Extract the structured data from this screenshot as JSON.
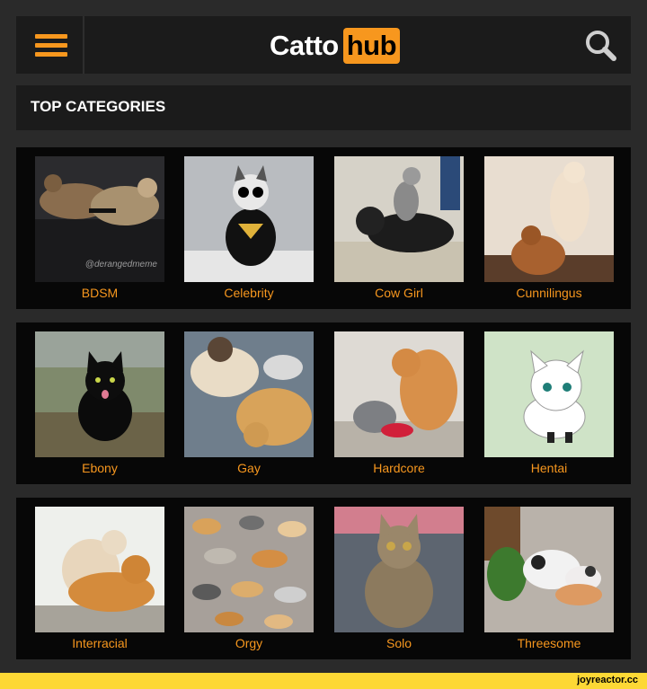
{
  "header": {
    "logo_white": "Catto",
    "logo_orange": "hub"
  },
  "section": {
    "title": "TOP CATEGORIES"
  },
  "categories": [
    {
      "label": "BDSM",
      "watermark": "@derangedmeme"
    },
    {
      "label": "Celebrity"
    },
    {
      "label": "Cow Girl"
    },
    {
      "label": "Cunnilingus"
    },
    {
      "label": "Ebony"
    },
    {
      "label": "Gay"
    },
    {
      "label": "Hardcore"
    },
    {
      "label": "Hentai"
    },
    {
      "label": "Interracial"
    },
    {
      "label": "Orgy"
    },
    {
      "label": "Solo"
    },
    {
      "label": "Threesome"
    }
  ],
  "footer": {
    "source": "joyreactor.cc"
  },
  "colors": {
    "accent": "#f7971e",
    "bar_bg": "#1b1b1b",
    "page_bg": "#2a2a2a",
    "row_bg": "#070707",
    "footer_bg": "#fdd835"
  },
  "icons": {
    "menu": "hamburger-icon",
    "search": "search-icon"
  }
}
